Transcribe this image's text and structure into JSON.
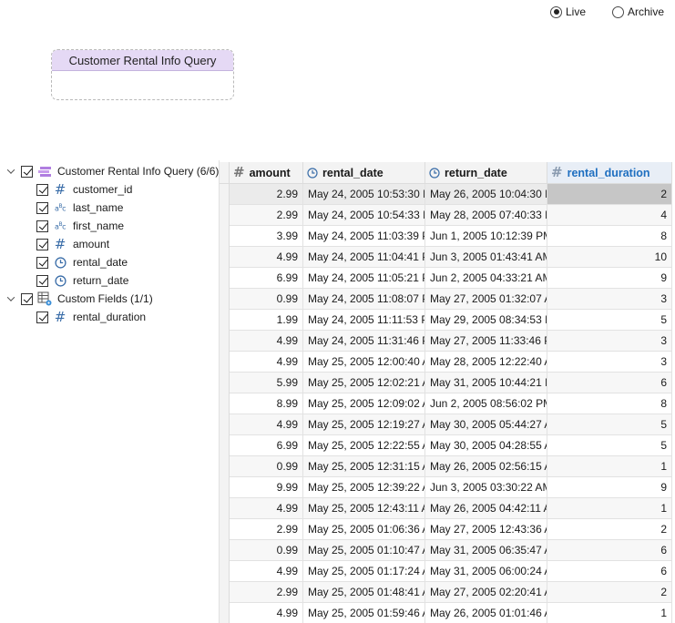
{
  "mode": {
    "live_label": "Live",
    "archive_label": "Archive",
    "selected": "live"
  },
  "query_node": {
    "title": "Customer Rental Info Query"
  },
  "tree": {
    "query_label": "Customer Rental Info Query (6/6)",
    "fields": [
      {
        "name": "customer_id",
        "type": "number-icon"
      },
      {
        "name": "last_name",
        "type": "text-icon"
      },
      {
        "name": "first_name",
        "type": "text-icon"
      },
      {
        "name": "amount",
        "type": "number-icon"
      },
      {
        "name": "rental_date",
        "type": "clock-icon"
      },
      {
        "name": "return_date",
        "type": "clock-icon"
      }
    ],
    "custom_label": "Custom Fields (1/1)",
    "custom_fields": [
      {
        "name": "rental_duration",
        "type": "number-icon"
      }
    ]
  },
  "grid": {
    "columns": [
      "amount",
      "rental_date",
      "return_date",
      "rental_duration"
    ],
    "rows": [
      [
        "2.99",
        "May 24, 2005 10:53:30 P",
        "May 26, 2005 10:04:30 P",
        "2"
      ],
      [
        "2.99",
        "May 24, 2005 10:54:33 P",
        "May 28, 2005 07:40:33 P",
        "4"
      ],
      [
        "3.99",
        "May 24, 2005 11:03:39 P",
        "Jun 1, 2005 10:12:39 PM",
        "8"
      ],
      [
        "4.99",
        "May 24, 2005 11:04:41 P",
        "Jun 3, 2005 01:43:41 AM",
        "10"
      ],
      [
        "6.99",
        "May 24, 2005 11:05:21 P",
        "Jun 2, 2005 04:33:21 AM",
        "9"
      ],
      [
        "0.99",
        "May 24, 2005 11:08:07 P",
        "May 27, 2005 01:32:07 A",
        "3"
      ],
      [
        "1.99",
        "May 24, 2005 11:11:53 P",
        "May 29, 2005 08:34:53 P",
        "5"
      ],
      [
        "4.99",
        "May 24, 2005 11:31:46 P",
        "May 27, 2005 11:33:46 P",
        "3"
      ],
      [
        "4.99",
        "May 25, 2005 12:00:40 A",
        "May 28, 2005 12:22:40 A",
        "3"
      ],
      [
        "5.99",
        "May 25, 2005 12:02:21 A",
        "May 31, 2005 10:44:21 P",
        "6"
      ],
      [
        "8.99",
        "May 25, 2005 12:09:02 A",
        "Jun 2, 2005 08:56:02 PM",
        "8"
      ],
      [
        "4.99",
        "May 25, 2005 12:19:27 A",
        "May 30, 2005 05:44:27 A",
        "5"
      ],
      [
        "6.99",
        "May 25, 2005 12:22:55 A",
        "May 30, 2005 04:28:55 A",
        "5"
      ],
      [
        "0.99",
        "May 25, 2005 12:31:15 A",
        "May 26, 2005 02:56:15 A",
        "1"
      ],
      [
        "9.99",
        "May 25, 2005 12:39:22 A",
        "Jun 3, 2005 03:30:22 AM",
        "9"
      ],
      [
        "4.99",
        "May 25, 2005 12:43:11 A",
        "May 26, 2005 04:42:11 A",
        "1"
      ],
      [
        "2.99",
        "May 25, 2005 01:06:36 A",
        "May 27, 2005 12:43:36 A",
        "2"
      ],
      [
        "0.99",
        "May 25, 2005 01:10:47 A",
        "May 31, 2005 06:35:47 A",
        "6"
      ],
      [
        "4.99",
        "May 25, 2005 01:17:24 A",
        "May 31, 2005 06:00:24 A",
        "6"
      ],
      [
        "2.99",
        "May 25, 2005 01:48:41 A",
        "May 27, 2005 02:20:41 A",
        "2"
      ],
      [
        "4.99",
        "May 25, 2005 01:59:46 A",
        "May 26, 2005 01:01:46 A",
        "1"
      ]
    ]
  },
  "colors": {
    "accent": "#1f6fc0",
    "query_header": "#e5d9f5",
    "icon_blue": "#3a6da8"
  }
}
